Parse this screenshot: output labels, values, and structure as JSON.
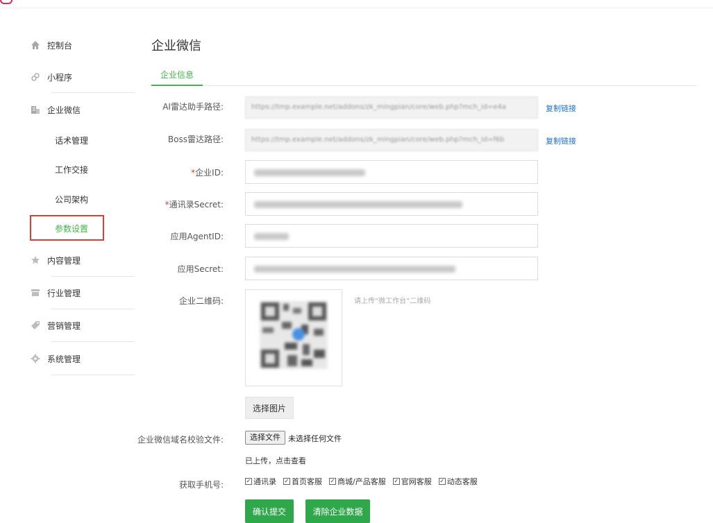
{
  "sidebar": {
    "items": [
      {
        "label": "控制台",
        "icon": "home-icon"
      },
      {
        "label": "小程序",
        "icon": "miniprogram-icon"
      },
      {
        "label": "企业微信",
        "icon": "building-icon"
      },
      {
        "label": "内容管理",
        "icon": "star-icon"
      },
      {
        "label": "行业管理",
        "icon": "store-icon"
      },
      {
        "label": "营销管理",
        "icon": "tag-icon"
      },
      {
        "label": "系统管理",
        "icon": "gear-icon"
      }
    ],
    "sub_items": [
      {
        "label": "话术管理"
      },
      {
        "label": "工作交接"
      },
      {
        "label": "公司架构"
      },
      {
        "label": "参数设置",
        "active": true
      }
    ]
  },
  "main": {
    "title": "企业微信",
    "tab": "企业信息",
    "form": {
      "ai_radar_label": "AI雷达助手路径:",
      "ai_radar_url": "https://tmp.example.net/addons/zk_mingpian/core/web.php?mch_id=e4a",
      "boss_radar_label": "Boss雷达路径:",
      "boss_radar_url": "https://tmp.example.net/addons/zk_mingpian/core/web.php?mch_id=f6b",
      "copy_link": "复制链接",
      "corp_id_label": "企业ID:",
      "secret_label": "通讯录Secret:",
      "agent_id_label": "应用AgentID:",
      "app_secret_label": "应用Secret:",
      "qr_label": "企业二维码:",
      "qr_hint": "请上传“微工作台”二维码",
      "choose_image": "选择图片",
      "domain_file_label": "企业微信域名校验文件:",
      "choose_file": "选择文件",
      "no_file": "未选择任何文件",
      "uploaded_view": "已上传，点击查看",
      "phone_label": "获取手机号:",
      "phone_options": [
        "通讯录",
        "首页客服",
        "商城/产品客服",
        "官网客服",
        "动态客服"
      ],
      "submit": "确认提交",
      "clear": "清除企业数据"
    }
  },
  "colors": {
    "accent": "#44b549",
    "button_green": "#2ea84a",
    "link": "#1b6fd1",
    "required": "#e53935"
  }
}
